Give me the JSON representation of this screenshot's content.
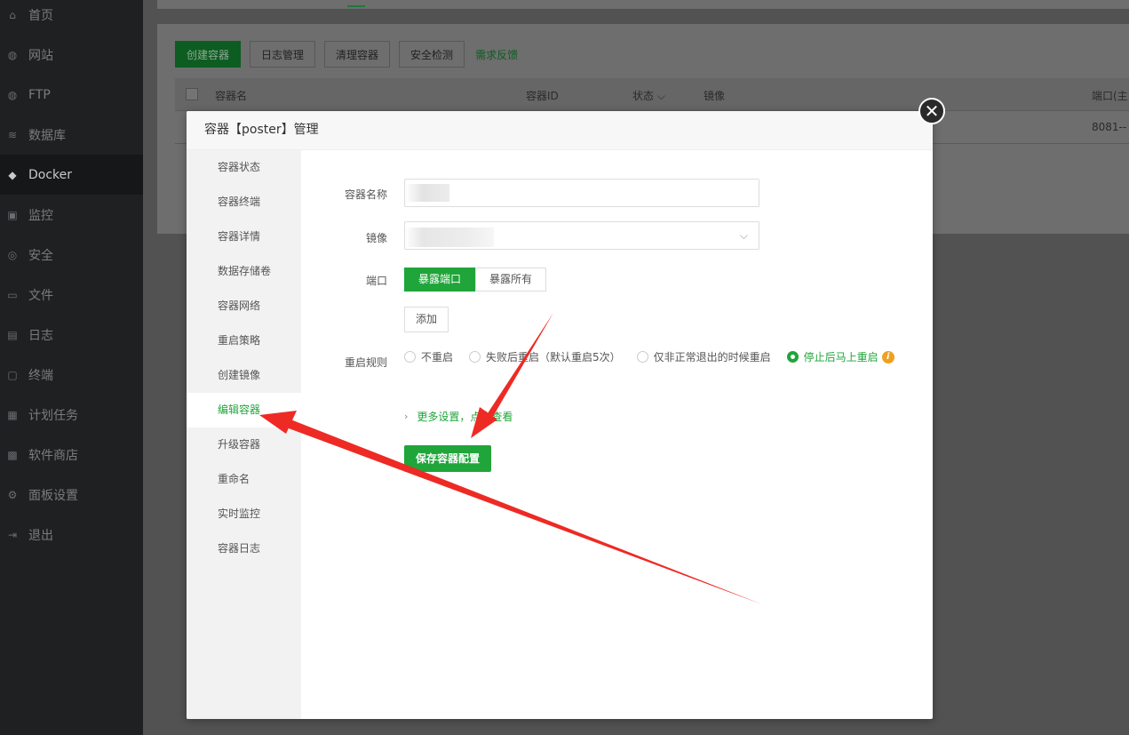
{
  "sidebar": {
    "items": [
      {
        "label": "首页",
        "icon": "home-icon",
        "glyph": "⌂"
      },
      {
        "label": "网站",
        "icon": "globe-icon",
        "glyph": "◍"
      },
      {
        "label": "FTP",
        "icon": "ftp-globe-icon",
        "glyph": "◍"
      },
      {
        "label": "数据库",
        "icon": "database-icon",
        "glyph": "≋"
      },
      {
        "label": "Docker",
        "icon": "docker-icon",
        "glyph": "◆"
      },
      {
        "label": "监控",
        "icon": "monitor-icon",
        "glyph": "▣"
      },
      {
        "label": "安全",
        "icon": "shield-icon",
        "glyph": "◎"
      },
      {
        "label": "文件",
        "icon": "folder-icon",
        "glyph": "▭"
      },
      {
        "label": "日志",
        "icon": "log-icon",
        "glyph": "▤"
      },
      {
        "label": "终端",
        "icon": "terminal-icon",
        "glyph": "▢"
      },
      {
        "label": "计划任务",
        "icon": "calendar-icon",
        "glyph": "▦"
      },
      {
        "label": "软件商店",
        "icon": "apps-icon",
        "glyph": "▩"
      },
      {
        "label": "面板设置",
        "icon": "gear-icon",
        "glyph": "⚙"
      },
      {
        "label": "退出",
        "icon": "logout-icon",
        "glyph": "⇥"
      }
    ]
  },
  "toolbar": {
    "create": "创建容器",
    "logs": "日志管理",
    "clean": "清理容器",
    "security": "安全检测",
    "feedback": "需求反馈"
  },
  "table": {
    "headers": {
      "name": "容器名",
      "id": "容器ID",
      "status": "状态",
      "image": "镜像",
      "port": "端口(主"
    },
    "row_port": "8081--"
  },
  "modal": {
    "title": "容器【poster】管理",
    "side_items": [
      "容器状态",
      "容器终端",
      "容器详情",
      "数据存储卷",
      "容器网络",
      "重启策略",
      "创建镜像",
      "编辑容器",
      "升级容器",
      "重命名",
      "实时监控",
      "容器日志"
    ],
    "active_index": 7,
    "form": {
      "name_label": "容器名称",
      "image_label": "镜像",
      "port_label": "端口",
      "port_expose": "暴露端口",
      "port_all": "暴露所有",
      "add": "添加",
      "restart_label": "重启规则",
      "restart_options": [
        "不重启",
        "失败后重启（默认重启5次）",
        "仅非正常退出的时候重启",
        "停止后马上重启"
      ],
      "restart_selected": 3,
      "more": "更多设置，点击查看",
      "save": "保存容器配置"
    }
  },
  "colors": {
    "accent": "#20a53a",
    "sidebar_bg": "#1e2022",
    "arrow": "#ee2a24"
  }
}
